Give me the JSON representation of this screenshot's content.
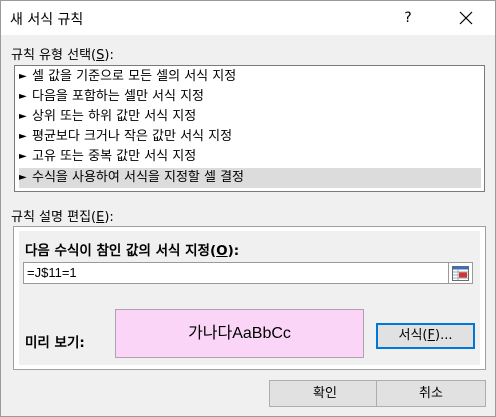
{
  "dialog": {
    "title": "새 서식 규칙",
    "help_label": "?",
    "close_icon": "close-icon"
  },
  "rule_type": {
    "label_prefix": "규칙 유형 선택(",
    "label_key": "S",
    "label_suffix": "):",
    "items": [
      {
        "label": "셀 값을 기준으로 모든 셀의 서식 지정",
        "selected": false
      },
      {
        "label": "다음을 포함하는 셀만 서식 지정",
        "selected": false
      },
      {
        "label": "상위 또는 하위 값만 서식 지정",
        "selected": false
      },
      {
        "label": "평균보다 크거나 작은 값만 서식 지정",
        "selected": false
      },
      {
        "label": "고유 또는 중복 값만 서식 지정",
        "selected": false
      },
      {
        "label": "수식을 사용하여 서식을 지정할 셀 결정",
        "selected": true
      }
    ],
    "arrow_glyph": "►"
  },
  "rule_desc": {
    "label_prefix": "규칙 설명 편집(",
    "label_key": "E",
    "label_suffix": "):",
    "formula_label_prefix": "다음 수식이 참인 값의 서식 지정(",
    "formula_label_key": "O",
    "formula_label_suffix": "):",
    "formula_value": "=J$11=1",
    "collapse_icon": "range-select-icon",
    "preview_label": "미리 보기:",
    "preview_text": "가나다AaBbCc",
    "preview_color": "#fbd5f7",
    "format_button_prefix": "서식(",
    "format_button_key": "F",
    "format_button_suffix": ")..."
  },
  "buttons": {
    "ok": "확인",
    "cancel": "취소"
  }
}
